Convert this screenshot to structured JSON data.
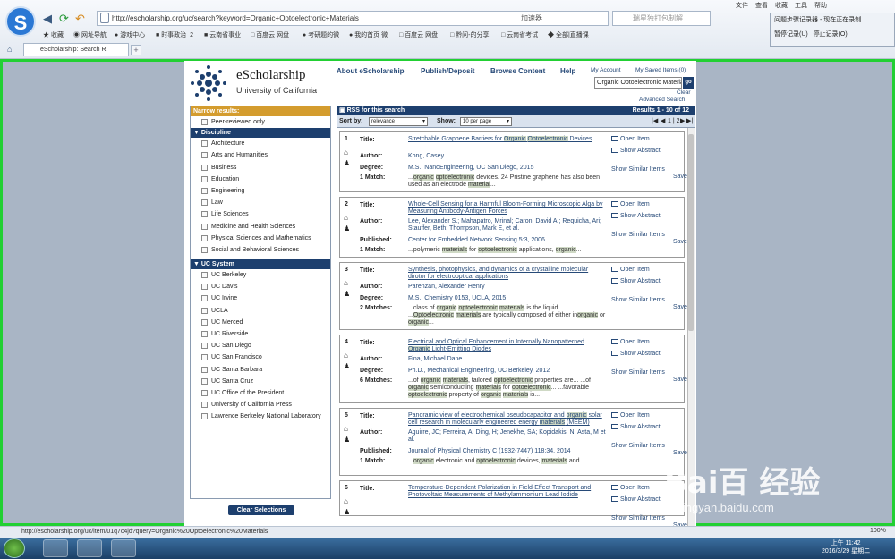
{
  "browser": {
    "url": "http://escholarship.org/uc/search?keyword=Organic+Optoelectronic+Materials",
    "accel": "加速器",
    "search_placeholder": "瑞星独打包制解",
    "menu": [
      "文件",
      "查看",
      "收藏",
      "工具",
      "帮助"
    ],
    "bookmarks": [
      "收藏",
      "网址导航",
      "游戏中心",
      "时事政治_2",
      "云南省事业",
      "百度云 网盘",
      "考研题的微",
      "我的首页 微",
      "百度云 网盘",
      "黔问-的分享",
      "云南省考试",
      "全部|直播课"
    ],
    "tab_title": "eScholarship: Search R",
    "recorder_title": "问题步骤记录器 - 现在正在录制",
    "recorder_pause": "暂停记录(U)",
    "recorder_stop": "停止记录(O)",
    "status_url": "http://escholarship.org/uc/item/01q7c4jd?query=Organic%20Optoelectronic%20Materials"
  },
  "site": {
    "title": "eScholarship",
    "subtitle": "University of California",
    "nav": [
      "About eScholarship",
      "Publish/Deposit",
      "Browse Content",
      "Help"
    ],
    "my_account": "My Account",
    "saved_items": "My Saved Items (0)",
    "search_value": "Organic Optoelectronic Materials",
    "go": "go",
    "clear": "Clear",
    "advanced": "Advanced Search"
  },
  "sidebar": {
    "narrow_label": "Narrow results:",
    "peer": "Peer-reviewed only",
    "discipline_header": "Discipline",
    "disciplines": [
      "Architecture",
      "Arts and Humanities",
      "Business",
      "Education",
      "Engineering",
      "Law",
      "Life Sciences",
      "Medicine and Health Sciences",
      "Physical Sciences and Mathematics",
      "Social and Behavioral Sciences"
    ],
    "uc_header": "UC System",
    "campuses": [
      "UC Berkeley",
      "UC Davis",
      "UC Irvine",
      "UCLA",
      "UC Merced",
      "UC Riverside",
      "UC San Diego",
      "UC San Francisco",
      "UC Santa Barbara",
      "UC Santa Cruz",
      "UC Office of the President",
      "University of California Press",
      "Lawrence Berkeley National Laboratory"
    ],
    "clear_button": "Clear Selections"
  },
  "results_bar": {
    "rss": "RSS for this search",
    "count": "Results 1 - 10 of 12",
    "sort_label": "Sort by:",
    "sort_value": "relevance",
    "show_label": "Show:",
    "show_value": "10 per page",
    "pager": "1 | 2"
  },
  "actions": {
    "open": "Open Item",
    "abstract": "Show Abstract",
    "similar": "Show Similar Items",
    "save": "Save"
  },
  "results": [
    {
      "num": "1",
      "title": "Stretchable Graphene Barriers for Organic Optoelectronic Devices",
      "author": "Kong, Casey",
      "meta_label": "Degree:",
      "meta": "M.S., NanoEngineering, UC San Diego, 2015",
      "match_label": "1 Match:",
      "match": "...organic optoelectronic devices. 24 Pristine graphene has also been used as an electrode material..."
    },
    {
      "num": "2",
      "title": "Whole-Cell Sensing for a Harmful Bloom-Forming Microscopic Alga by Measuring Antibody-Antigen Forces",
      "author": "Lee, Alexander S.; Mahapatro, Mrinal; Caron, David A.; Requicha, Ari; Stauffer, Beth; Thompson, Mark E, et al.",
      "meta_label": "Published:",
      "meta": "Center for Embedded Network Sensing 5:3, 2006",
      "match_label": "1 Match:",
      "match": "...polymeric materials for optoelectronic applications, organic..."
    },
    {
      "num": "3",
      "title": "Synthesis, photophysics, and dynamics of a crystalline molecular dirotor for electrooptical applications",
      "author": "Parenzan, Alexander Henry",
      "meta_label": "Degree:",
      "meta": "M.S., Chemistry 0153, UCLA, 2015",
      "match_label": "2 Matches:",
      "match": "...class of organic optoelectronic materials is the liquid... ...Optoelectronic materials are typically composed of either inorganic or organic..."
    },
    {
      "num": "4",
      "title": "Electrical and Optical Enhancement in Internally Nanopatterned Organic Light-Emitting Diodes",
      "author": "Fina, Michael Dane",
      "meta_label": "Degree:",
      "meta": "Ph.D., Mechanical Engineering, UC Berkeley, 2012",
      "match_label": "6 Matches:",
      "match": "...of organic materials, tailored optoelectronic properties are... ...of organic semiconducting materials for optoelectronic... ...favorable optoelectronic property of organic materials is..."
    },
    {
      "num": "5",
      "title": "Panoramic view of electrochemical pseudocapacitor and organic solar cell research in molecularly engineered energy materials (MEEM)",
      "author": "Aguirre, JC; Ferreira, A; Ding, H; Jenekhe, SA; Kopidakis, N; Asta, M et al.",
      "meta_label": "Published:",
      "meta": "Journal of Physical Chemistry C (1932-7447) 118:34, 2014",
      "match_label": "1 Match:",
      "match": "...organic electronic and optoelectronic devices, materials and..."
    },
    {
      "num": "6",
      "title": "Temperature-Dependent Polarization in Field-Effect Transport and Photovoltaic Measurements of Methylammonium Lead Iodide",
      "author": "",
      "meta_label": "",
      "meta": "",
      "match_label": "",
      "match": ""
    }
  ],
  "labels": {
    "title": "Title:",
    "author": "Author:"
  },
  "taskbar": {
    "time": "上午 11:42",
    "date": "2016/3/29 星期二",
    "zoom": "100%"
  },
  "watermark": {
    "brand": "Bai百 经验",
    "sub": "jingyan.baidu.com"
  }
}
